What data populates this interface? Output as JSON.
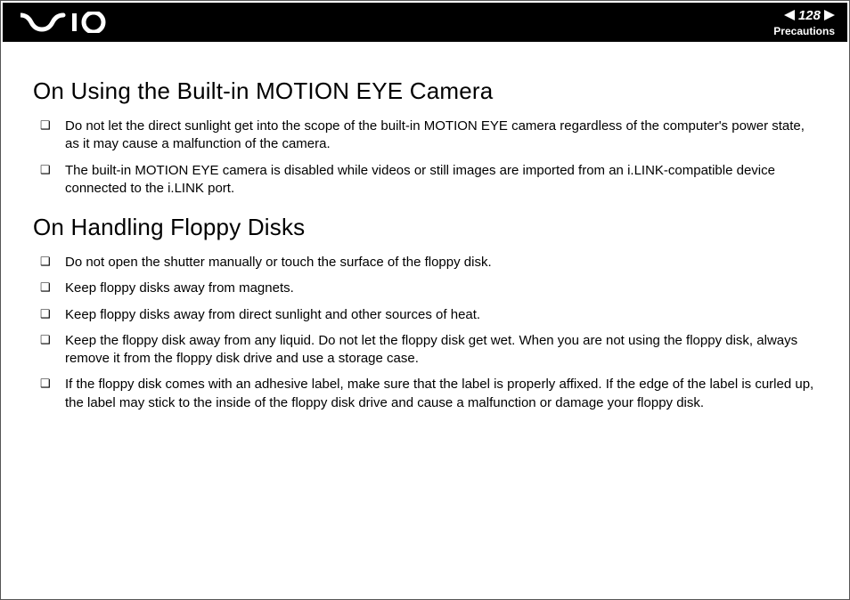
{
  "header": {
    "page_number": "128",
    "section_name": "Precautions"
  },
  "content": {
    "sections": [
      {
        "heading": "On Using the Built-in MOTION EYE Camera",
        "items": [
          "Do not let the direct sunlight get into the scope of the built-in MOTION EYE camera regardless of the computer's power state, as it may cause a malfunction of the camera.",
          "The built-in MOTION EYE camera is disabled while videos or still images are imported from an i.LINK-compatible device connected to the i.LINK port."
        ]
      },
      {
        "heading": "On Handling Floppy Disks",
        "items": [
          "Do not open the shutter manually or touch the surface of the floppy disk.",
          "Keep floppy disks away from magnets.",
          "Keep floppy disks away from direct sunlight and other sources of heat.",
          "Keep the floppy disk away from any liquid. Do not let the floppy disk get wet. When you are not using the floppy disk, always remove it from the floppy disk drive and use a storage case.",
          "If the floppy disk comes with an adhesive label, make sure that the label is properly affixed. If the edge of the label is curled up, the label may stick to the inside of the floppy disk drive and cause a malfunction or damage your floppy disk."
        ]
      }
    ]
  }
}
